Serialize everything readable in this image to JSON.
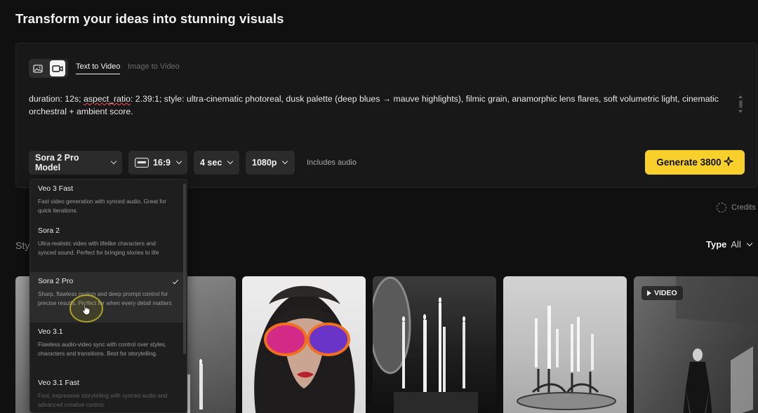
{
  "header": {
    "title": "Transform your ideas into stunning visuals"
  },
  "composer": {
    "tabs": [
      {
        "label": "Text to Video",
        "active": true
      },
      {
        "label": "Image to Video",
        "active": false
      }
    ],
    "mode_icons": [
      "image-icon",
      "video-camera-icon"
    ],
    "prompt": {
      "pre": " duration: 12s; ",
      "underlined": "aspect_ratio",
      "post": ": 2.39:1; style: ultra-cinematic photoreal, dusk palette (deep blues → mauve highlights), filmic grain, anamorphic lens flares, soft volumetric light, cinematic orchestral + ambient score."
    },
    "controls": {
      "model": "Sora 2 Pro Model",
      "ratio": "16:9",
      "duration": "4 sec",
      "resolution": "1080p",
      "audio_note": "Includes audio"
    },
    "generate": {
      "label": "Generate 3800",
      "icon": "sparkle-icon"
    }
  },
  "credits": {
    "label": "Credits"
  },
  "styles": {
    "label": "Sty"
  },
  "filter": {
    "label": "Type",
    "value": "All"
  },
  "model_menu": {
    "items": [
      {
        "name": "Veo 3 Fast",
        "desc": "Fast video generation with synced audio. Great for quick iterations.",
        "selected": false
      },
      {
        "name": "Sora 2",
        "desc": "Ultra-realistic video with lifelike characters and synced sound. Perfect for bringing stories to life",
        "selected": false
      },
      {
        "name": "Sora 2 Pro",
        "desc": "Sharp, flawless motion and deep prompt control for precise results. Perfect for when every detail matters",
        "selected": true
      },
      {
        "name": "Veo 3.1",
        "desc": "Flawless audio-video sync with control over styles, characters and transitions. Best for storytelling.",
        "selected": false
      },
      {
        "name": "Veo 3.1 Fast",
        "desc": "Fast, expressive storytelling with synced audio and advanced creative control.",
        "selected": false
      }
    ]
  },
  "gallery": {
    "video_badge": "VIDEO",
    "cards": [
      "candles-closeup",
      "woman-sunglasses-portrait",
      "candles-mirror",
      "candelabra-table",
      "woman-suit-room"
    ]
  },
  "colors": {
    "accent": "#F8CF2B",
    "background": "#101010",
    "panel": "#181818"
  }
}
